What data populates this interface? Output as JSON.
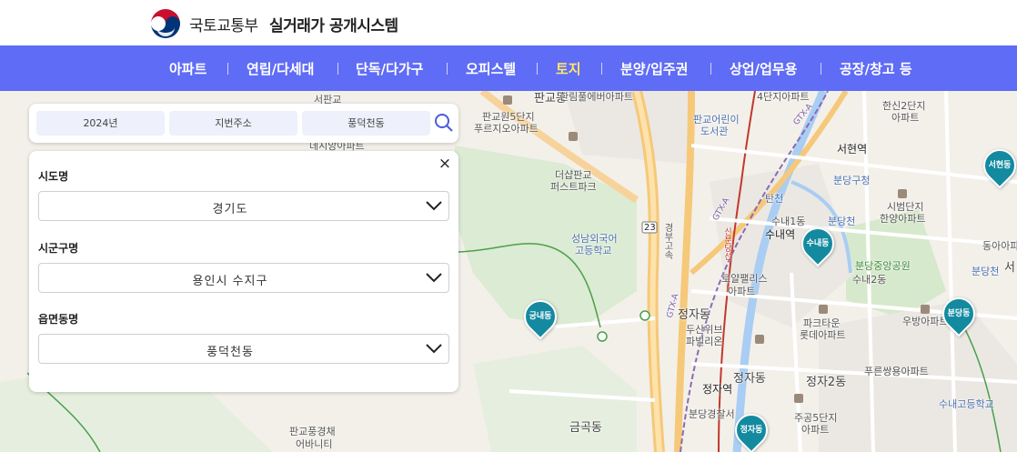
{
  "header": {
    "org_name": "국토교통부",
    "system_name": "실거래가 공개시스템"
  },
  "nav": {
    "items": [
      {
        "label": "아파트"
      },
      {
        "label": "연립/다세대"
      },
      {
        "label": "단독/다가구"
      },
      {
        "label": "오피스텔"
      },
      {
        "label": "토지"
      },
      {
        "label": "분양/입주권"
      },
      {
        "label": "상업/업무용"
      },
      {
        "label": "공장/창고 등"
      }
    ],
    "active_index": 4,
    "background": "#5f6cf5",
    "active_color": "#ffe86a"
  },
  "search": {
    "year": "2024년",
    "address_type": "지번주소",
    "dong": "풍덕천동"
  },
  "filter_panel": {
    "close_label": "×",
    "province_label": "시도명",
    "province_value": "경기도",
    "district_label": "시군구명",
    "district_value": "용인시 수지구",
    "town_label": "읍면동명",
    "town_value": "풍덕천동"
  },
  "map": {
    "labels": {
      "pangyo_dong": "판교동",
      "hanlim": "한림풀에버아파트",
      "pangyo_5": "판교원5단지",
      "pureuji": "푸르지오아파트",
      "pangyo_kids": "판교어린이",
      "library": "도서관",
      "apt4": "4단지아파트",
      "hansin2": "한신2단지",
      "apt_a": "아파트",
      "seohyeon_st": "서현역",
      "bundang_gu": "분당구청",
      "sibeom": "시범단지",
      "hanyang": "한양아파트",
      "deshap1": "더샵판교",
      "deshap2": "퍼스트파크",
      "seongnam1": "성남외국어",
      "seongnam2": "고등학교",
      "tancheon": "탄천",
      "sunae1": "수내1동",
      "bundang_cheon": "분당천",
      "sunae_st": "수내역",
      "central_park": "분당중앙공원",
      "sunae2": "수내2동",
      "rose1": "로얄팰리스",
      "rose2": "아파트",
      "jeongja_dong_n": "정자동",
      "dusan1": "두산위브",
      "dusan2": "파빌리온",
      "park1": "파크타운",
      "park2": "롯데아파트",
      "woobang": "우방아파트",
      "purun": "푸른쌍용아파트",
      "jeongja_dong": "정자동",
      "jeongja_st": "정자역",
      "jeongja2": "정자2동",
      "bundang_police": "분당경찰서",
      "jugong1": "주공5단지",
      "jugong2": "아파트",
      "geumgok": "금곡동",
      "pangyo_pung1": "판교풍경채",
      "pangyo_pung2": "어바니티",
      "sunae_school": "수내고등학교",
      "dongal": "동아아파",
      "bundang_cheon2": "분당천",
      "gyeongbu": "경부고속",
      "seopangyo": "서판교",
      "dexiap": "데시앙아파트",
      "bundang_seo": "서",
      "road_23": "23",
      "gtx1": "GTX-A",
      "gtx2": "GTX-A",
      "gtx3": "GTX-A",
      "sinbundang": "신분당선"
    },
    "pins": {
      "seohyeon": "서현동",
      "sunae": "수내동",
      "bundang": "분당동",
      "gungnae": "궁내동",
      "jeongja": "정자동"
    }
  }
}
